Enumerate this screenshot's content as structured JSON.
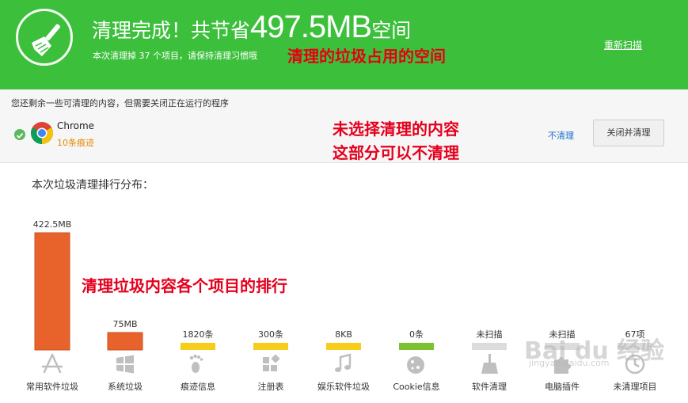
{
  "header": {
    "title_prefix": "清理完成！共节省",
    "title_amount": "497.5MB",
    "title_suffix": "空间",
    "subtitle": "本次清理掉 37 个项目，请保持清理习惯哦",
    "annotation": "清理的垃圾占用的空间",
    "rescan_label": "重新扫描",
    "bg_color": "#3cc03c"
  },
  "remaining": {
    "title": "您还剩余一些可清理的内容，但需要关闭正在运行的程序",
    "app_name": "Chrome",
    "app_count": "10条痕迹",
    "annotation_line1": "未选择清理的内容",
    "annotation_line2": "这部分可以不清理",
    "no_clean_label": "不清理",
    "close_clean_label": "关闭并清理"
  },
  "ranking": {
    "title": "本次垃圾清理排行分布：",
    "annotation": "清理垃圾内容各个项目的排行"
  },
  "watermark": {
    "main": "Bai du 经验",
    "sub": "jingyan.baidu.com"
  },
  "chart_data": {
    "type": "bar",
    "categories": [
      "常用软件垃圾",
      "系统垃圾",
      "痕迹信息",
      "注册表",
      "娱乐软件垃圾",
      "Cookie信息",
      "软件清理",
      "电脑插件",
      "未清理项目"
    ],
    "value_labels": [
      "422.5MB",
      "75MB",
      "1820条",
      "300条",
      "8KB",
      "0条",
      "未扫描",
      "未扫描",
      "67项"
    ],
    "values_mb": [
      422.5,
      75,
      null,
      null,
      null,
      null,
      null,
      null,
      null
    ],
    "bar_colors": [
      "#e8622c",
      "#e8622c",
      "#f5cd1a",
      "#f5cd1a",
      "#f5cd1a",
      "#7cc230",
      "#dcdcdc",
      "#dcdcdc",
      "#dcdcdc"
    ],
    "icons": [
      "app-store-icon",
      "windows-icon",
      "footprint-icon",
      "registry-icon",
      "music-icon",
      "cookie-icon",
      "broom-icon",
      "plugin-icon",
      "clock-icon"
    ],
    "ylim": [
      0,
      422.5
    ]
  }
}
